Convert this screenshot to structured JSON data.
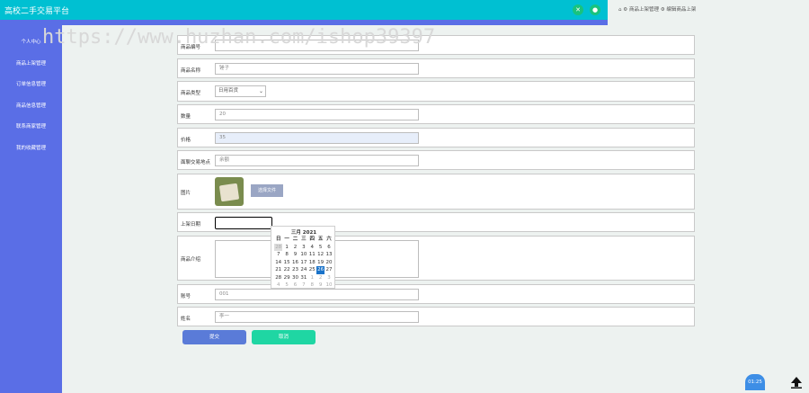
{
  "app": {
    "title": "高校二手交易平台"
  },
  "breadcrumb": {
    "items": [
      "商品上架管理",
      "编辑商品上架"
    ]
  },
  "watermark": "https://www.huzhan.com/ishop39397",
  "sidebar": {
    "items": [
      {
        "label": "个人中心"
      },
      {
        "label": "商品上架管理"
      },
      {
        "label": "订单信息管理"
      },
      {
        "label": "商品信息管理"
      },
      {
        "label": "联系商家管理"
      },
      {
        "label": "我的收藏管理"
      }
    ]
  },
  "form": {
    "code_label": "商品编号",
    "name_label": "商品名称",
    "name_value": "锤子",
    "category_label": "商品类型",
    "category_value": "日用百货",
    "quantity_label": "数量",
    "quantity_value": "20",
    "price_label": "价格",
    "price_value": "35",
    "location_label": "面聊交易地点",
    "location_value": "余额",
    "image_label": "图片",
    "choose_file": "选择文件",
    "date_label": "上架日期",
    "intro_label": "商品介绍",
    "account_label": "账号",
    "account_value": "001",
    "name2_label": "姓名",
    "name2_value": "李一"
  },
  "buttons": {
    "submit": "提交",
    "cancel": "取消"
  },
  "calendar": {
    "title": "三月 2021",
    "weekdays": [
      "日",
      "一",
      "二",
      "三",
      "四",
      "五",
      "六"
    ],
    "weeks": [
      [
        "28",
        "1",
        "2",
        "3",
        "4",
        "5",
        "6"
      ],
      [
        "7",
        "8",
        "9",
        "10",
        "11",
        "12",
        "13"
      ],
      [
        "14",
        "15",
        "16",
        "17",
        "18",
        "19",
        "20"
      ],
      [
        "21",
        "22",
        "23",
        "24",
        "25",
        "26",
        "27"
      ],
      [
        "28",
        "29",
        "30",
        "31",
        "1",
        "2",
        "3"
      ],
      [
        "4",
        "5",
        "6",
        "7",
        "8",
        "9",
        "10"
      ]
    ],
    "selected": "26"
  },
  "timer": "01:25",
  "colors": {
    "topbar": "#00c0d2",
    "sidebar": "#5a6ee6",
    "submit": "#5a7bd8",
    "cancel": "#1fd6a3"
  }
}
